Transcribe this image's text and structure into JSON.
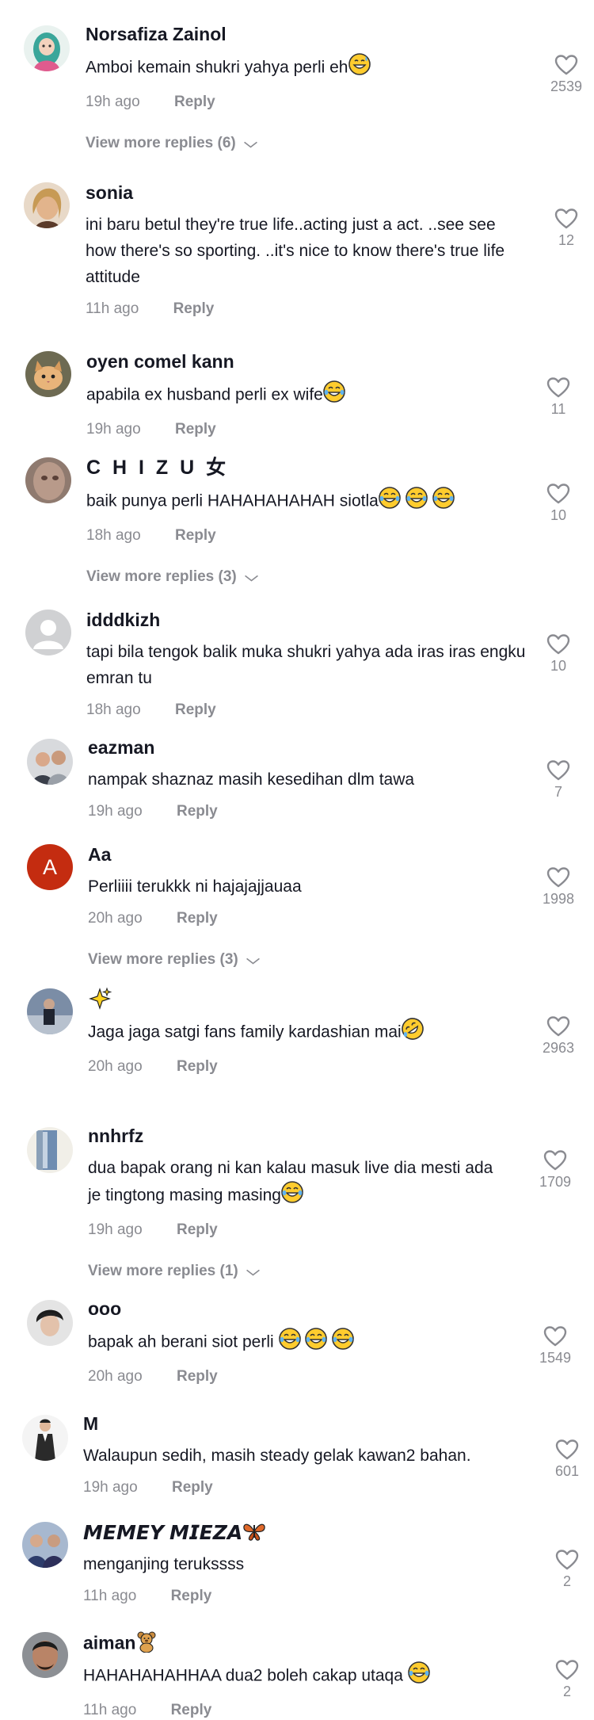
{
  "labels": {
    "reply": "Reply"
  },
  "colors": {
    "muted": "#8a8b91",
    "text": "#161823",
    "avatar_a": "#c42c10"
  },
  "comments": [
    {
      "username": "Norsafiza Zainol",
      "text": "Amboi kemain shukri yahya perli eh",
      "emojis": [
        "grin-sweat"
      ],
      "time": "19h ago",
      "likes": "2539",
      "more_replies": "View more replies (6)"
    },
    {
      "username": "sonia",
      "text": "ini baru betul they're true life..acting just a act. ..see see how there's so sporting. ..it's nice to know there's true life attitude",
      "emojis": [],
      "time": "11h ago",
      "likes": "12"
    },
    {
      "username": "oyen comel kann",
      "text": "apabila ex husband perli ex wife",
      "emojis": [
        "tears-of-joy"
      ],
      "time": "19h ago",
      "likes": "11"
    },
    {
      "username": "C H I Z U 女",
      "text": "baik punya perli HAHAHAHAHAH siotla",
      "emojis": [
        "tears-of-joy",
        "tears-of-joy",
        "tears-of-joy"
      ],
      "time": "18h ago",
      "likes": "10",
      "more_replies": "View more replies (3)"
    },
    {
      "username": "idddkizh",
      "text": "tapi bila tengok balik muka shukri yahya ada iras iras engku emran tu",
      "emojis": [],
      "time": "18h ago",
      "likes": "10"
    },
    {
      "username": "eazman",
      "text": "nampak shaznaz masih kesedihan dlm tawa",
      "emojis": [],
      "time": "19h ago",
      "likes": "7"
    },
    {
      "username": "Aa",
      "avatar_letter": "A",
      "text": "Perliiii terukkk ni hajajajjauaa",
      "emojis": [],
      "time": "20h ago",
      "likes": "1998",
      "more_replies": "View more replies (3)"
    },
    {
      "username": "",
      "username_emoji": "sparkles",
      "text": "Jaga jaga satgi fans family kardashian mai",
      "emojis": [
        "rofl"
      ],
      "time": "20h ago",
      "likes": "2963"
    },
    {
      "username": "nnhrfz",
      "text": "dua bapak orang ni kan kalau masuk live dia mesti ada je tingtong masing masing",
      "emojis": [
        "tears-of-joy"
      ],
      "time": "19h ago",
      "likes": "1709",
      "more_replies": "View more replies (1)"
    },
    {
      "username": "ooo",
      "text": "bapak ah berani siot perli",
      "emojis": [
        "tears-of-joy",
        "tears-of-joy",
        "tears-of-joy"
      ],
      "time": "20h ago",
      "likes": "1549"
    },
    {
      "username": "M",
      "text": "Walaupun sedih, masih steady gelak kawan2 bahan.",
      "emojis": [],
      "time": "19h ago",
      "likes": "601"
    },
    {
      "username": "𝙈𝙀𝙈𝙀𝙔 𝙈𝙄𝙀𝙕𝘼",
      "username_emoji": "butterfly",
      "text": "menganjing terukssss",
      "emojis": [],
      "time": "11h ago",
      "likes": "2"
    },
    {
      "username": "aiman",
      "username_emoji": "teddy-bear",
      "text": "HAHAHAHAHHAA dua2 boleh cakap utaqa",
      "emojis": [
        "tears-of-joy"
      ],
      "time": "11h ago",
      "likes": "2"
    }
  ]
}
